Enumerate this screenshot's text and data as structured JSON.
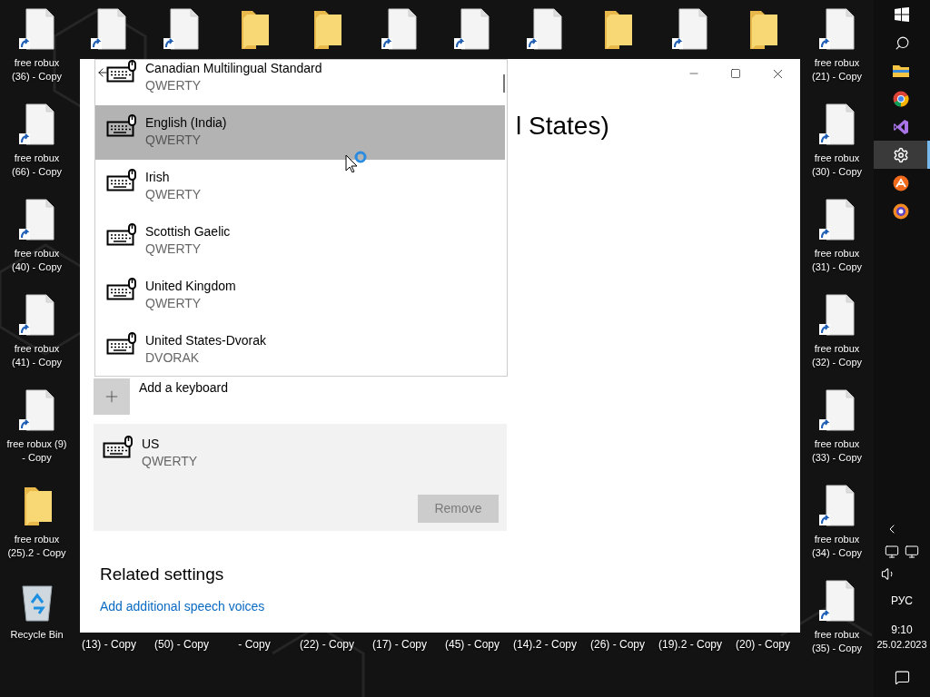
{
  "desktop": {
    "left_column": [
      {
        "kind": "file",
        "label": "free robux (36) - Copy"
      },
      {
        "kind": "file",
        "label": "free robux (66) - Copy"
      },
      {
        "kind": "file",
        "label": "free robux (40) - Copy"
      },
      {
        "kind": "file",
        "label": "free robux (41) - Copy"
      },
      {
        "kind": "file",
        "label": "free robux (9) - Copy"
      },
      {
        "kind": "folder",
        "label": "free robux (25).2 - Copy"
      },
      {
        "kind": "recycle",
        "label": "Recycle Bin"
      }
    ],
    "right_column": [
      {
        "kind": "file",
        "label": "free robux (21) - Copy"
      },
      {
        "kind": "file",
        "label": "free robux (30) - Copy"
      },
      {
        "kind": "file",
        "label": "free robux (31) - Copy"
      },
      {
        "kind": "file",
        "label": "free robux (32) - Copy"
      },
      {
        "kind": "file",
        "label": "free robux (33) - Copy"
      },
      {
        "kind": "file",
        "label": "free robux (34) - Copy"
      },
      {
        "kind": "file",
        "label": "free robux (35) - Copy"
      }
    ],
    "top_row": [
      {
        "kind": "file"
      },
      {
        "kind": "file"
      },
      {
        "kind": "folder"
      },
      {
        "kind": "folder"
      },
      {
        "kind": "file"
      },
      {
        "kind": "file"
      },
      {
        "kind": "file"
      },
      {
        "kind": "folder"
      },
      {
        "kind": "file"
      },
      {
        "kind": "folder"
      }
    ],
    "bottom_row_labels": [
      "(13) - Copy",
      "(50) - Copy",
      "- Copy",
      "(22) - Copy",
      "(17) - Copy",
      "(45) - Copy",
      "(14).2 - Copy",
      "(26) - Copy",
      "(19).2 - Copy",
      "(20) - Copy"
    ]
  },
  "settings_window": {
    "title_fragment": "l States)",
    "keyboard_list": [
      {
        "name": "Canadian Multilingual Standard",
        "layout": "QWERTY",
        "highlighted": false
      },
      {
        "name": "English (India)",
        "layout": "QWERTY",
        "highlighted": true
      },
      {
        "name": "Irish",
        "layout": "QWERTY",
        "highlighted": false
      },
      {
        "name": "Scottish Gaelic",
        "layout": "QWERTY",
        "highlighted": false
      },
      {
        "name": "United Kingdom",
        "layout": "QWERTY",
        "highlighted": false
      },
      {
        "name": "United States-Dvorak",
        "layout": "DVORAK",
        "highlighted": false
      }
    ],
    "add_keyboard": "Add a keyboard",
    "installed_keyboard": {
      "name": "US",
      "layout": "QWERTY",
      "remove_button": {
        "label": "Remove",
        "disabled": true
      }
    },
    "related_settings": {
      "heading": "Related settings",
      "link": "Add additional speech voices"
    }
  },
  "taskbar": {
    "apps": [
      {
        "kind": "explorer",
        "active": false
      },
      {
        "kind": "chrome",
        "active": false
      },
      {
        "kind": "studio",
        "active": false
      },
      {
        "kind": "settings",
        "active": true
      },
      {
        "kind": "orange",
        "active": false
      },
      {
        "kind": "browser",
        "active": false
      }
    ],
    "language": "РУС",
    "time": "9:10",
    "date": "25.02.2023"
  }
}
